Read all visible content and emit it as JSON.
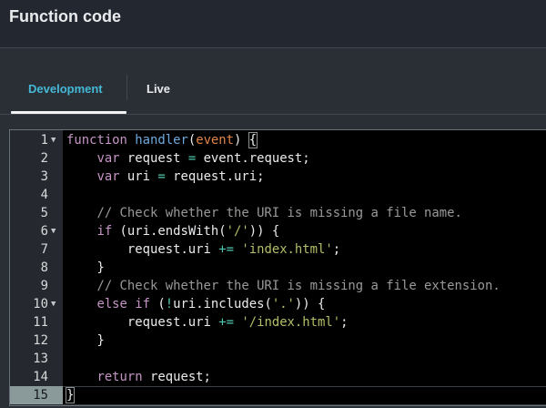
{
  "header": {
    "title": "Function code"
  },
  "tabs": [
    {
      "label": "Development",
      "active": true
    },
    {
      "label": "Live",
      "active": false
    }
  ],
  "editor": {
    "active_line": 15,
    "lines": [
      {
        "n": "1",
        "fold": true,
        "tokens": [
          [
            "kw",
            "function"
          ],
          [
            "pl",
            " "
          ],
          [
            "fn",
            "handler"
          ],
          [
            "pl",
            "("
          ],
          [
            "param",
            "event"
          ],
          [
            "pl",
            ") "
          ],
          [
            "bm",
            "{"
          ]
        ]
      },
      {
        "n": "2",
        "tokens": [
          [
            "pl",
            "    "
          ],
          [
            "kw",
            "var"
          ],
          [
            "pl",
            " request "
          ],
          [
            "op",
            "="
          ],
          [
            "pl",
            " event.request;"
          ]
        ]
      },
      {
        "n": "3",
        "tokens": [
          [
            "pl",
            "    "
          ],
          [
            "kw",
            "var"
          ],
          [
            "pl",
            " uri "
          ],
          [
            "op",
            "="
          ],
          [
            "pl",
            " request.uri;"
          ]
        ]
      },
      {
        "n": "4",
        "tokens": []
      },
      {
        "n": "5",
        "tokens": [
          [
            "pl",
            "    "
          ],
          [
            "cm",
            "// Check whether the URI is missing a file name."
          ]
        ]
      },
      {
        "n": "6",
        "fold": true,
        "tokens": [
          [
            "pl",
            "    "
          ],
          [
            "kw",
            "if"
          ],
          [
            "pl",
            " (uri.endsWith("
          ],
          [
            "str",
            "'/'"
          ],
          [
            "pl",
            ")) {"
          ]
        ]
      },
      {
        "n": "7",
        "tokens": [
          [
            "pl",
            "        request.uri "
          ],
          [
            "op",
            "+="
          ],
          [
            "pl",
            " "
          ],
          [
            "str",
            "'index.html'"
          ],
          [
            "pl",
            ";"
          ]
        ]
      },
      {
        "n": "8",
        "tokens": [
          [
            "pl",
            "    }"
          ]
        ]
      },
      {
        "n": "9",
        "tokens": [
          [
            "pl",
            "    "
          ],
          [
            "cm",
            "// Check whether the URI is missing a file extension."
          ]
        ]
      },
      {
        "n": "10",
        "fold": true,
        "tokens": [
          [
            "pl",
            "    "
          ],
          [
            "kw",
            "else if"
          ],
          [
            "pl",
            " ("
          ],
          [
            "op",
            "!"
          ],
          [
            "pl",
            "uri.includes("
          ],
          [
            "str",
            "'.'"
          ],
          [
            "pl",
            ")) {"
          ]
        ]
      },
      {
        "n": "11",
        "tokens": [
          [
            "pl",
            "        request.uri "
          ],
          [
            "op",
            "+="
          ],
          [
            "pl",
            " "
          ],
          [
            "str",
            "'/index.html'"
          ],
          [
            "pl",
            ";"
          ]
        ]
      },
      {
        "n": "12",
        "tokens": [
          [
            "pl",
            "    }"
          ]
        ]
      },
      {
        "n": "13",
        "tokens": []
      },
      {
        "n": "14",
        "tokens": [
          [
            "pl",
            "    "
          ],
          [
            "kw",
            "return"
          ],
          [
            "pl",
            " request;"
          ]
        ]
      },
      {
        "n": "15",
        "tokens": [
          [
            "bm",
            "}"
          ]
        ]
      }
    ]
  }
}
